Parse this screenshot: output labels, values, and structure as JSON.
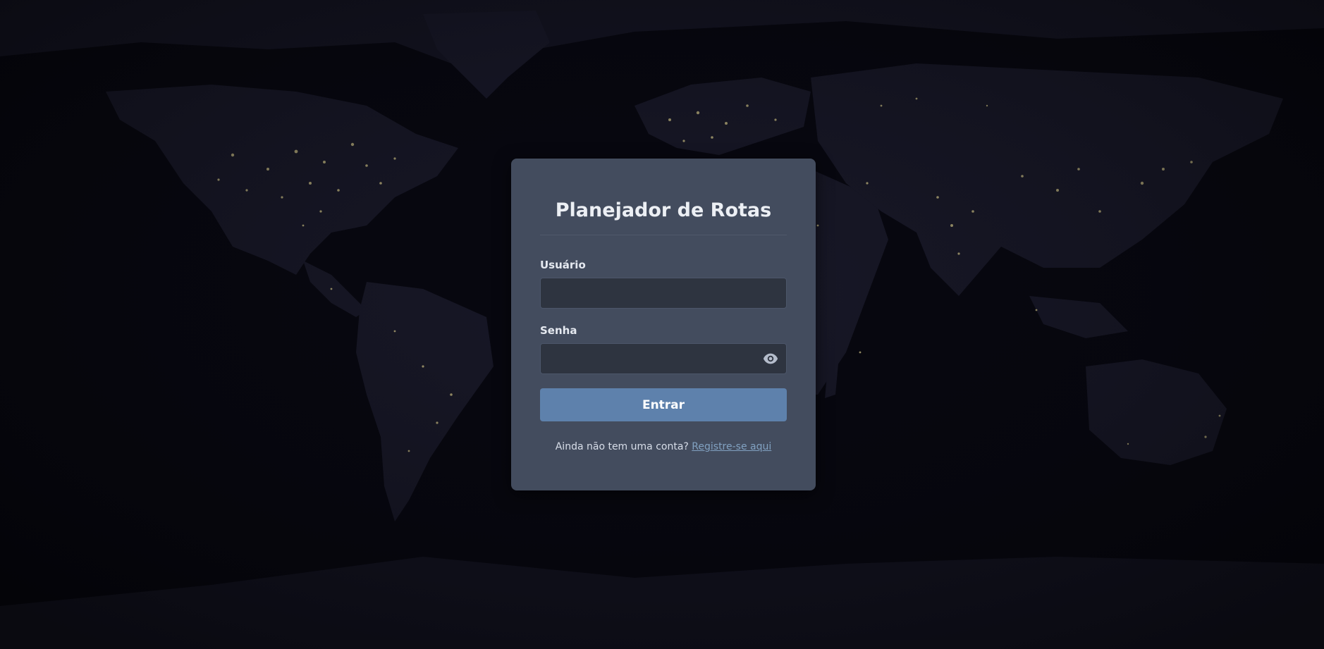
{
  "login": {
    "title": "Planejador de Rotas",
    "username_label": "Usuário",
    "username_value": "",
    "password_label": "Senha",
    "password_value": "",
    "toggle_icon": "eye-icon",
    "submit_label": "Entrar",
    "register_prompt": "Ainda não tem uma conta?",
    "register_link": "Registre-se aqui"
  },
  "background": {
    "description_icon": "world-map-night-lights",
    "base_color": "#07070f",
    "land_color": "#1a1a2a",
    "lights_color": "#d9cc8c"
  },
  "colors": {
    "card": "#434c5e",
    "input": "#2e3440",
    "button": "#5e81ac",
    "link": "#81a1c1"
  }
}
